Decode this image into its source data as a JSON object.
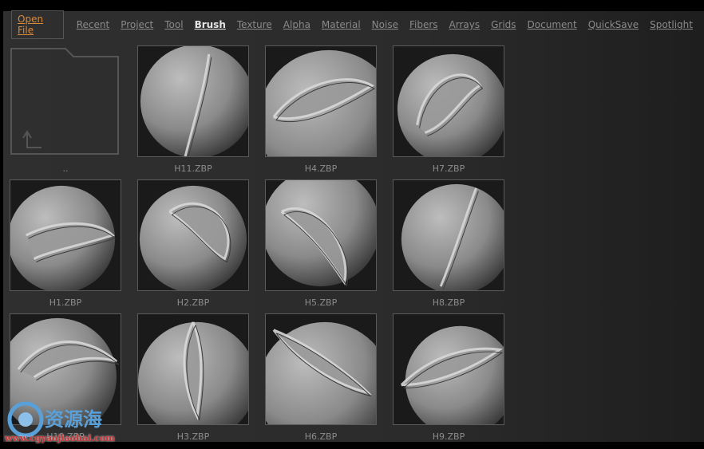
{
  "tabs": [
    {
      "label": "Open File",
      "state": "action"
    },
    {
      "label": "Recent"
    },
    {
      "label": "Project"
    },
    {
      "label": "Tool"
    },
    {
      "label": "Brush",
      "state": "active"
    },
    {
      "label": "Texture"
    },
    {
      "label": "Alpha"
    },
    {
      "label": "Material"
    },
    {
      "label": "Noise"
    },
    {
      "label": "Fibers"
    },
    {
      "label": "Arrays"
    },
    {
      "label": "Grids"
    },
    {
      "label": "Document"
    },
    {
      "label": "QuickSave"
    },
    {
      "label": "Spotlight"
    }
  ],
  "parent_folder": {
    "label": "..",
    "icon": "folder-up-icon"
  },
  "files": [
    {
      "name": "H11.ZBP"
    },
    {
      "name": "H4.ZBP"
    },
    {
      "name": "H7.ZBP"
    },
    {
      "name": "H1.ZBP"
    },
    {
      "name": "H2.ZBP"
    },
    {
      "name": "H5.ZBP"
    },
    {
      "name": "H8.ZBP"
    },
    {
      "name": "H10.ZBP"
    },
    {
      "name": "H3.ZBP"
    },
    {
      "name": "H6.ZBP"
    },
    {
      "name": "H9.ZBP"
    }
  ],
  "watermark": {
    "text": "资源海",
    "url": "www.cgyaojiaohai.com"
  },
  "colors": {
    "accent": "#d88a3c",
    "active_tab": "#e6e6e6",
    "tab": "#8a8a8a"
  }
}
